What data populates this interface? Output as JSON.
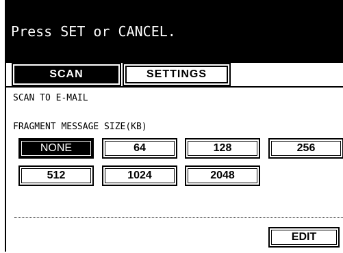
{
  "header": {
    "prompt": "Press SET or CANCEL."
  },
  "tabs": [
    {
      "label": "SCAN",
      "active": true
    },
    {
      "label": "SETTINGS",
      "active": false
    }
  ],
  "panel": {
    "title": "SCAN TO E-MAIL",
    "section_label": "FRAGMENT MESSAGE SIZE(KB)",
    "options": [
      "NONE",
      "64",
      "128",
      "256",
      "512",
      "1024",
      "2048"
    ],
    "selected": "NONE",
    "edit_label": "EDIT"
  }
}
